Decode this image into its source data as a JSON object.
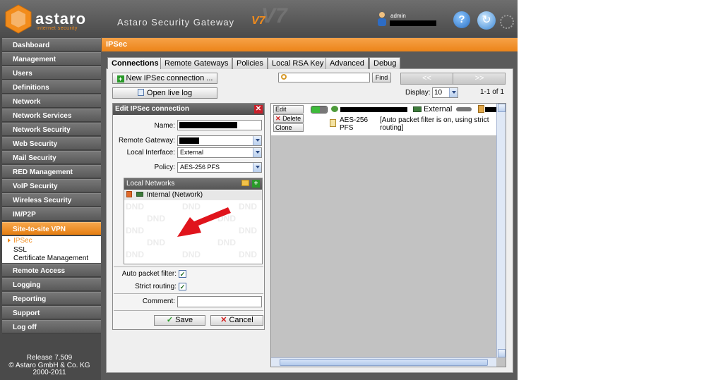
{
  "header": {
    "logo_text": "astaro",
    "logo_sub": "internet security",
    "product_title": "Astaro Security Gateway",
    "version_badge": "V7",
    "version_ghost": "V7",
    "user_label": "admin",
    "help_symbol": "?",
    "refresh_symbol": "↻"
  },
  "sidebar": {
    "items": [
      "Dashboard",
      "Management",
      "Users",
      "Definitions",
      "Network",
      "Network Services",
      "Network Security",
      "Web Security",
      "Mail Security",
      "RED Management",
      "VoIP Security",
      "Wireless Security",
      "IM/P2P",
      "Site-to-site VPN",
      "Remote Access",
      "Logging",
      "Reporting",
      "Support",
      "Log off"
    ],
    "active": "Site-to-site VPN",
    "subitems": [
      "IPSec",
      "SSL",
      "Certificate Management"
    ],
    "active_subitem": "IPSec"
  },
  "release": {
    "line1": "Release 7.509",
    "line2": "© Astaro GmbH & Co. KG",
    "line3": "2000-2011"
  },
  "page": {
    "title": "IPSec"
  },
  "tabs": [
    "Connections",
    "Remote Gateways",
    "Policies",
    "Local RSA Key",
    "Advanced",
    "Debug"
  ],
  "active_tab": "Connections",
  "toolbar": {
    "new_connection": "New IPSec connection ...",
    "open_live_log": "Open live log",
    "find": "Find",
    "search_value": "",
    "pager_prev": "<<",
    "pager_next": ">>",
    "display_label": "Display:",
    "display_value": "10",
    "page_count": "1-1 of 1"
  },
  "edit_panel": {
    "title": "Edit IPSec connection",
    "close_symbol": "✕",
    "name_label": "Name:",
    "remote_gateway_label": "Remote Gateway:",
    "local_interface_label": "Local Interface:",
    "local_interface_value": "External",
    "policy_label": "Policy:",
    "policy_value": "AES-256 PFS",
    "local_networks_title": "Local Networks",
    "local_network_entry": "Internal (Network)",
    "dnd_text": "DND",
    "auto_packet_filter_label": "Auto packet filter:",
    "auto_packet_filter_checked": true,
    "strict_routing_label": "Strict routing:",
    "strict_routing_checked": true,
    "comment_label": "Comment:",
    "comment_value": "",
    "save_label": "Save",
    "cancel_label": "Cancel",
    "check_mark": "✓"
  },
  "connection": {
    "edit": "Edit",
    "delete": "Delete",
    "clone": "Clone",
    "interface": "External",
    "policy": "AES-256 PFS",
    "note": "[Auto packet filter is on, using strict routing]",
    "status_on": true
  },
  "colors": {
    "accent": "#f28c1c",
    "header_dark": "#4a4a4a",
    "status_green": "#3dbb3a",
    "arrow_red": "#e0141c"
  }
}
